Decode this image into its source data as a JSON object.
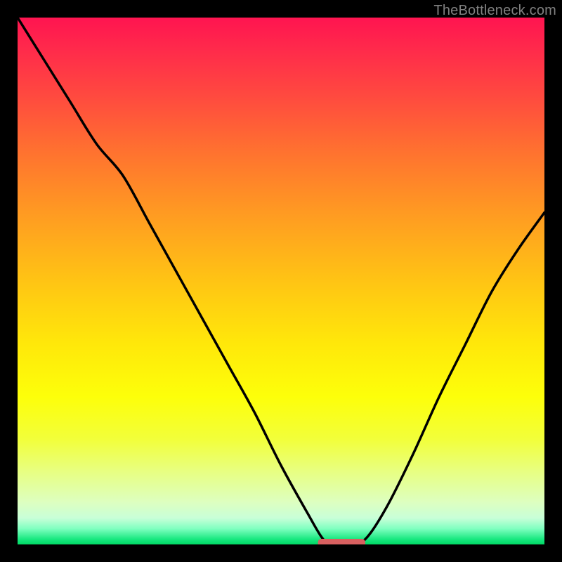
{
  "watermark": "TheBottleneck.com",
  "colors": {
    "frame": "#000000",
    "curve": "#000000",
    "marker": "#d86060",
    "gradient_top": "#ff1450",
    "gradient_bottom": "#00d864",
    "watermark": "#808080"
  },
  "chart_data": {
    "type": "line",
    "title": "",
    "xlabel": "",
    "ylabel": "",
    "xlim": [
      0,
      100
    ],
    "ylim": [
      0,
      100
    ],
    "note": "Axes are unlabeled; values are estimated percentages of plot width (x) and height (y). y=0 is bottom, y=100 is top.",
    "x": [
      0,
      5,
      10,
      15,
      20,
      25,
      30,
      35,
      40,
      45,
      50,
      55,
      58,
      60,
      63,
      66,
      70,
      75,
      80,
      85,
      90,
      95,
      100
    ],
    "y": [
      100,
      92,
      84,
      76,
      70,
      61,
      52,
      43,
      34,
      25,
      15,
      6,
      1,
      0,
      0,
      1,
      7,
      17,
      28,
      38,
      48,
      56,
      63
    ],
    "marker": {
      "x_range": [
        57,
        66
      ],
      "y": 0
    },
    "grid": false,
    "legend": null
  }
}
